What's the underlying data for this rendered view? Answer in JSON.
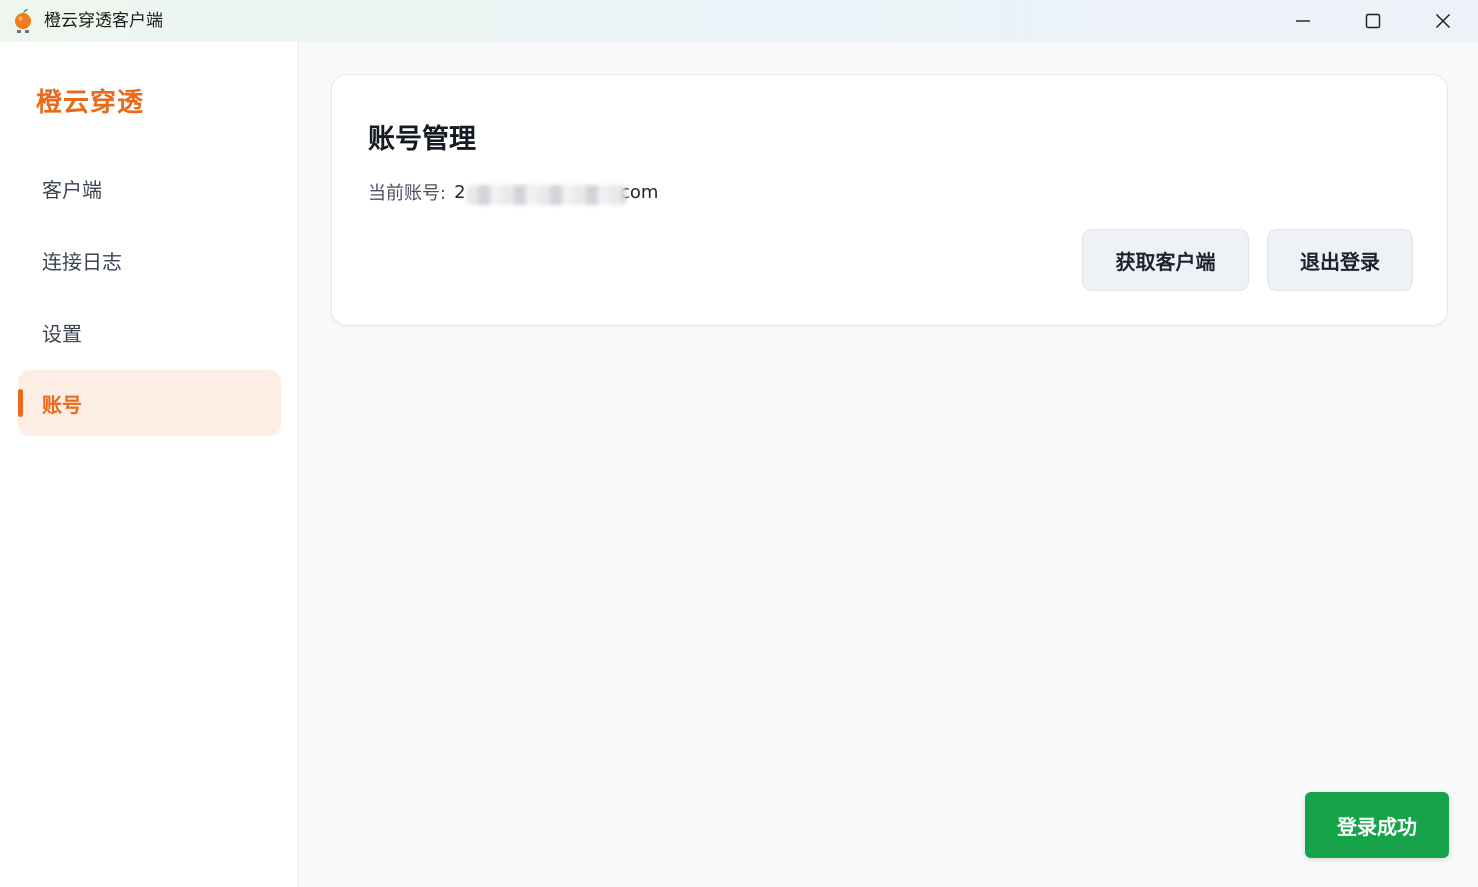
{
  "window": {
    "title": "橙云穿透客户端",
    "icon": "orange-fruit-icon"
  },
  "window_controls": {
    "minimize_icon": "minimize-icon",
    "maximize_icon": "maximize-icon",
    "close_icon": "close-icon"
  },
  "sidebar": {
    "brand": "橙云穿透",
    "items": [
      {
        "label": "客户端",
        "active": false
      },
      {
        "label": "连接日志",
        "active": false
      },
      {
        "label": "设置",
        "active": false
      },
      {
        "label": "账号",
        "active": true
      }
    ]
  },
  "account_card": {
    "title": "账号管理",
    "current_account_label": "当前账号:",
    "current_account_value": "2                      pp.com",
    "buttons": {
      "get_client": "获取客户端",
      "logout": "退出登录"
    }
  },
  "toast": {
    "message": "登录成功"
  },
  "colors": {
    "accent": "#ea6a1b",
    "active_bg": "#fdeee5",
    "success": "#16a34a",
    "main_bg": "#f8f9fb"
  }
}
